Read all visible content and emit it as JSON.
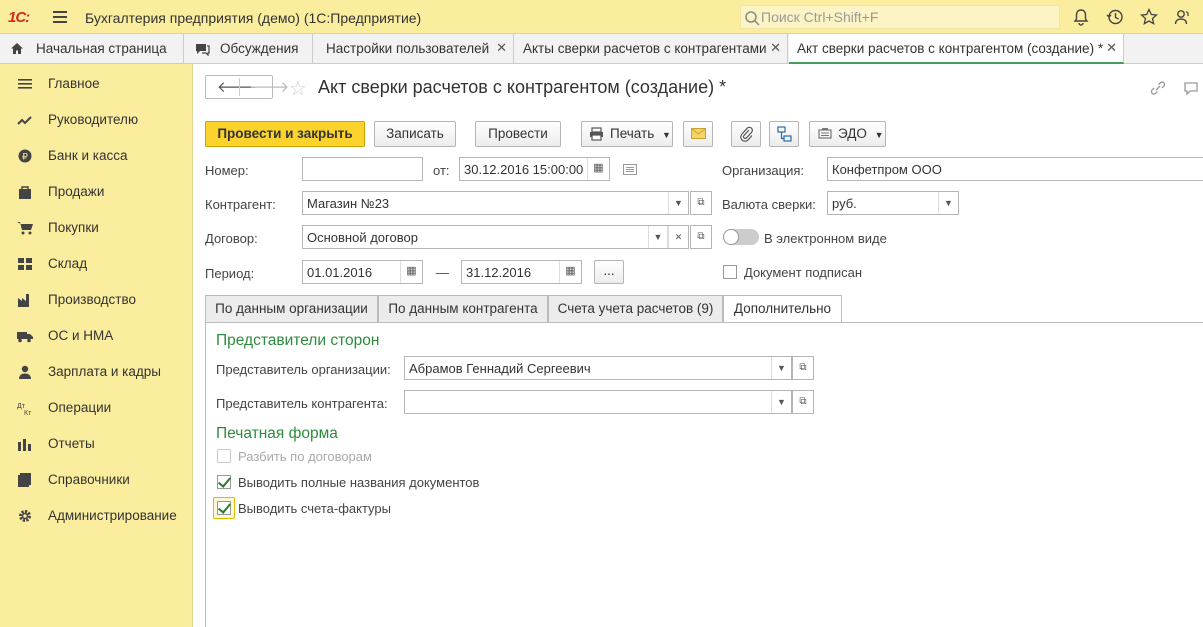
{
  "app": {
    "logo": "1С:",
    "title": "Бухгалтерия предприятия (демо)  (1С:Предприятие)",
    "search_placeholder": "Поиск Ctrl+Shift+F"
  },
  "tabs": [
    {
      "label": "Начальная страница"
    },
    {
      "label": "Обсуждения"
    },
    {
      "label": "Настройки пользователей"
    },
    {
      "label": "Акты сверки расчетов с контрагентами"
    },
    {
      "label": "Акт сверки расчетов с контрагентом (создание) *"
    }
  ],
  "sidebar": {
    "items": [
      {
        "label": "Главное"
      },
      {
        "label": "Руководителю"
      },
      {
        "label": "Банк и касса"
      },
      {
        "label": "Продажи"
      },
      {
        "label": "Покупки"
      },
      {
        "label": "Склад"
      },
      {
        "label": "Производство"
      },
      {
        "label": "ОС и НМА"
      },
      {
        "label": "Зарплата и кадры"
      },
      {
        "label": "Операции"
      },
      {
        "label": "Отчеты"
      },
      {
        "label": "Справочники"
      },
      {
        "label": "Администрирование"
      }
    ]
  },
  "doc": {
    "title": "Акт сверки расчетов с контрагентом (создание) *"
  },
  "toolbar": {
    "post_close": "Провести и закрыть",
    "save": "Записать",
    "post": "Провести",
    "print": "Печать",
    "edo": "ЭДО"
  },
  "form": {
    "number_label": "Номер:",
    "number_value": "",
    "from_label": "от:",
    "date_value": "30.12.2016 15:00:00",
    "org_label": "Организация:",
    "org_value": "Конфетпром ООО",
    "contractor_label": "Контрагент:",
    "contractor_value": "Магазин №23",
    "currency_label": "Валюта сверки:",
    "currency_value": "руб.",
    "contract_label": "Договор:",
    "contract_value": "Основной договор",
    "electronic_label": "В электронном виде",
    "period_label": "Период:",
    "period_start": "01.01.2016",
    "period_dash": "—",
    "period_end": "31.12.2016",
    "period_more": "...",
    "signed_label": "Документ подписан"
  },
  "form_tabs": [
    {
      "label": "По данным организации"
    },
    {
      "label": "По данным контрагента"
    },
    {
      "label": "Счета учета расчетов (9)"
    },
    {
      "label": "Дополнительно"
    }
  ],
  "panel": {
    "reps_title": "Представители сторон",
    "rep_org_label": "Представитель организации:",
    "rep_org_value": "Абрамов Геннадий Сергеевич",
    "rep_contr_label": "Представитель контрагента:",
    "rep_contr_value": "",
    "print_title": "Печатная форма",
    "split_label": "Разбить по договорам",
    "split_checked": false,
    "full_names_label": "Выводить полные названия документов",
    "full_names_checked": true,
    "invoices_label": "Выводить счета-фактуры",
    "invoices_checked": true
  },
  "colors": {
    "topbar": "#fbed9e",
    "accent_green": "#2e8b3e",
    "primary_button": "#fbd32c",
    "logo_red": "#d52b1e"
  }
}
